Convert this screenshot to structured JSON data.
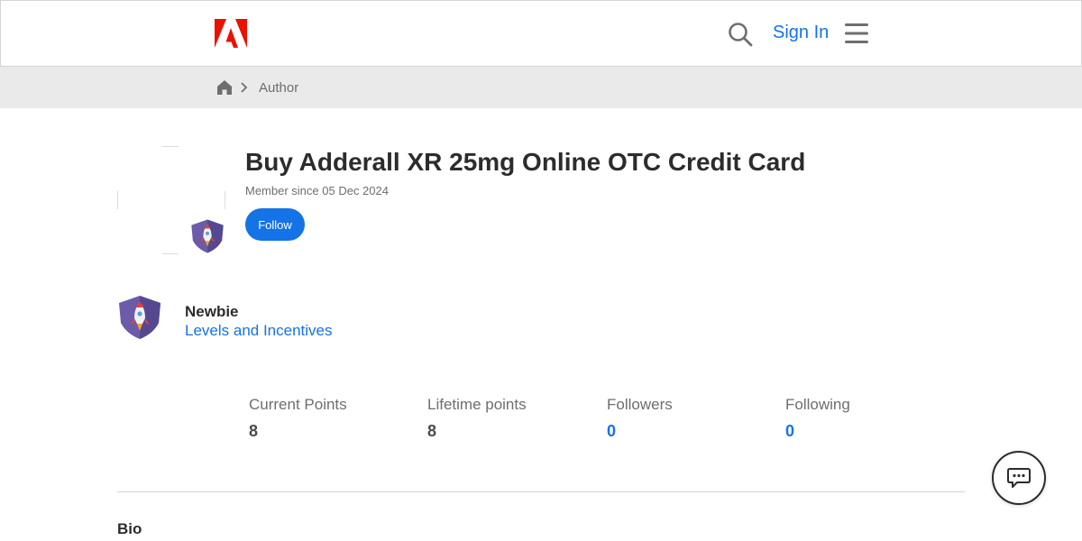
{
  "header": {
    "logo_icon": "adobe-logo",
    "search_icon": "search-icon",
    "sign_in_label": "Sign In",
    "menu_icon": "hamburger-menu-icon",
    "brand_color": "#eb1000",
    "link_color": "#1473e6"
  },
  "breadcrumb": {
    "home_icon": "home-icon",
    "separator_icon": "chevron-right-icon",
    "current": "Author"
  },
  "profile": {
    "name": "Buy Adderall XR 25mg Online OTC Credit Card",
    "member_since": "Member since 05 Dec 2024",
    "follow_label": "Follow",
    "avatar_badge_icon": "rocket-shield-badge-icon"
  },
  "rank": {
    "name": "Newbie",
    "link_label": "Levels and Incentives",
    "badge_icon": "rocket-shield-badge-icon"
  },
  "stats": [
    {
      "label": "Current Points",
      "value": "8"
    },
    {
      "label": "Lifetime points",
      "value": "8"
    },
    {
      "label": "Followers",
      "value": "0"
    },
    {
      "label": "Following",
      "value": "0"
    }
  ],
  "bio": {
    "heading": "Bio"
  },
  "chat": {
    "icon": "chat-bubble-icon"
  }
}
